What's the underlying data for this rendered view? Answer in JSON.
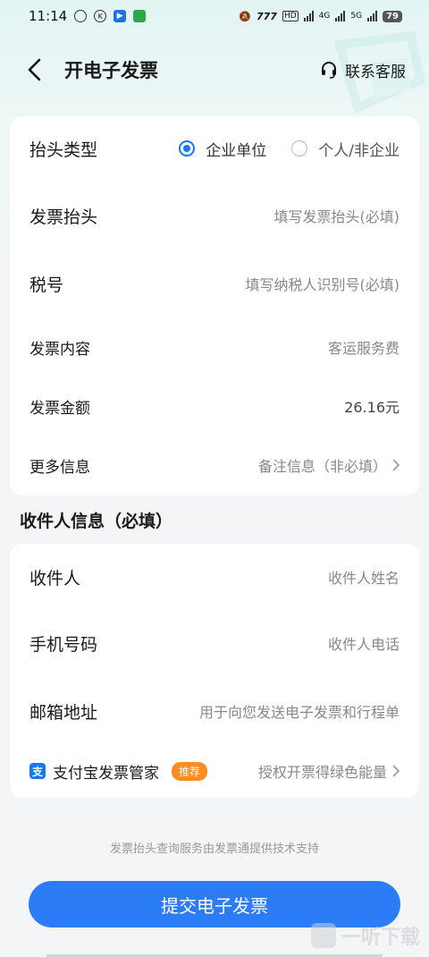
{
  "status_bar": {
    "time": "11:14",
    "network_a": "777",
    "network_hd": "HD",
    "network_4g": "4G",
    "network_5g": "5G",
    "battery": "79"
  },
  "header": {
    "title": "开电子发票",
    "contact_label": "联系客服"
  },
  "invoice": {
    "title_type_label": "抬头类型",
    "title_type_options": [
      "企业单位",
      "个人/非企业"
    ],
    "title_type_selected": "企业单位",
    "invoice_title_label": "发票抬头",
    "invoice_title_placeholder": "填写发票抬头(必填)",
    "tax_id_label": "税号",
    "tax_id_placeholder": "填写纳税人识别号(必填)",
    "content_label": "发票内容",
    "content_value": "客运服务费",
    "amount_label": "发票金额",
    "amount_value": "26.16元",
    "more_label": "更多信息",
    "more_value": "备注信息（非必填）"
  },
  "recipient": {
    "section_title": "收件人信息（必填）",
    "name_label": "收件人",
    "name_placeholder": "收件人姓名",
    "phone_label": "手机号码",
    "phone_placeholder": "收件人电话",
    "email_label": "邮箱地址",
    "email_placeholder": "用于向您发送电子发票和行程单",
    "alipay_label": "支付宝发票管家",
    "alipay_badge": "推荐",
    "alipay_value": "授权开票得绿色能量"
  },
  "footer": {
    "note": "发票抬头查询服务由发票通提供技术支持",
    "submit_label": "提交电子发票"
  },
  "watermark": {
    "text": "一听下载"
  },
  "colors": {
    "accent": "#2b7cf6",
    "radio": "#1677ff",
    "badge": "#ff8a1f"
  }
}
